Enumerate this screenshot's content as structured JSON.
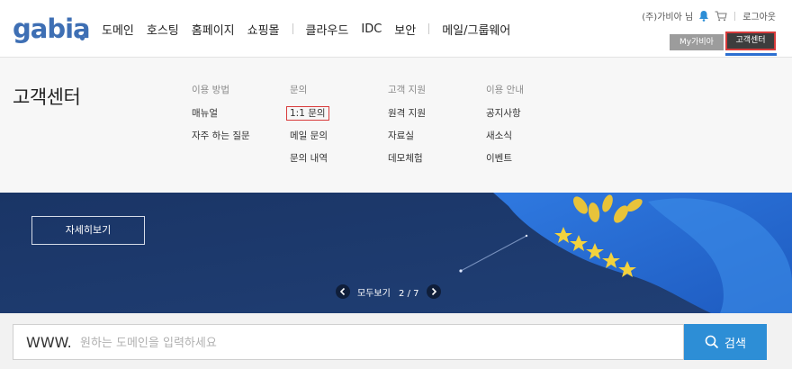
{
  "logo": {
    "text": "gabia"
  },
  "gnb": {
    "group1": [
      "도메인",
      "호스팅",
      "홈페이지",
      "쇼핑몰"
    ],
    "group2": [
      "클라우드",
      "IDC",
      "보안"
    ],
    "group3": [
      "메일/그룹웨어"
    ]
  },
  "util": {
    "user": "(주)가비아 님",
    "logout": "로그아웃",
    "my_gabia": "My가비아",
    "customer_center": "고객센터"
  },
  "mega": {
    "title": "고객센터",
    "columns": [
      {
        "heading": "이용 방법",
        "links": [
          "매뉴얼",
          "자주 하는 질문"
        ]
      },
      {
        "heading": "문의",
        "links": [
          "1:1 문의",
          "메일 문의",
          "문의 내역"
        ]
      },
      {
        "heading": "고객 지원",
        "links": [
          "원격 지원",
          "자료실",
          "데모체험"
        ]
      },
      {
        "heading": "이용 안내",
        "links": [
          "공지사항",
          "새소식",
          "이벤트"
        ]
      }
    ]
  },
  "banner": {
    "detail_button": "자세히보기",
    "pager_label": "모두보기",
    "pager_current": "2",
    "pager_total": "7"
  },
  "search": {
    "prefix": "WWW.",
    "placeholder": "원하는 도메인을 입력하세요",
    "button": "검색"
  },
  "colors": {
    "brand": "#3e6fb4",
    "banner_bg": "#1d3a6e",
    "search_button": "#2d8ed6",
    "highlight_border": "#d83a3a"
  }
}
